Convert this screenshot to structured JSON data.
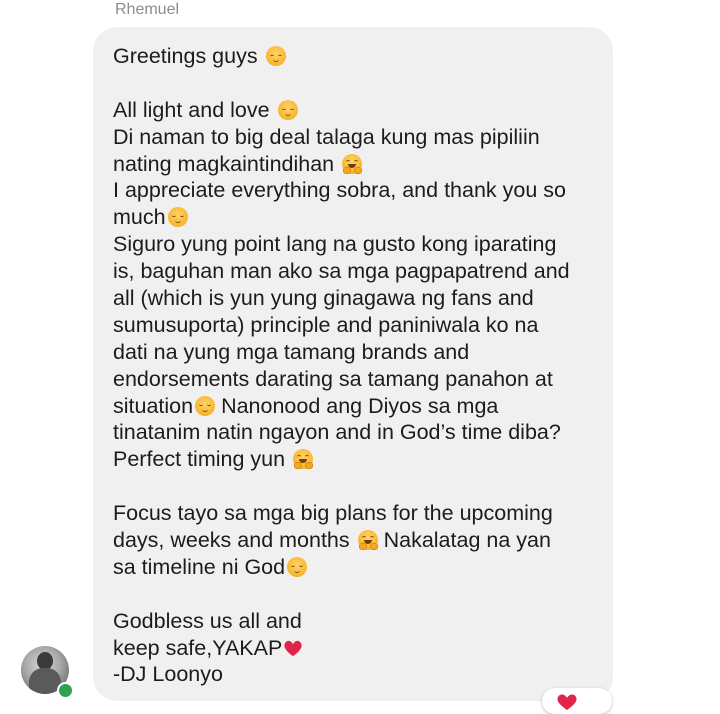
{
  "sender": {
    "name": "Rhemuel"
  },
  "message": {
    "lines": [
      {
        "text": "Greetings guys ",
        "emoji": "relieved-face-icon"
      },
      {
        "text": "",
        "emoji": ""
      },
      {
        "text": "All light and love ",
        "emoji": "relieved-face-icon"
      },
      {
        "text": "Di naman to big deal talaga kung mas pipiliin",
        "emoji": ""
      },
      {
        "text": "nating magkaintindihan ",
        "emoji": "hugging-face-icon"
      },
      {
        "text": "I appreciate everything sobra, and thank you so",
        "emoji": ""
      },
      {
        "text": "much",
        "emoji": "relieved-face-icon"
      },
      {
        "text": "Siguro yung point lang na gusto kong iparating",
        "emoji": ""
      },
      {
        "text": "is, baguhan man ako sa mga pagpapatrend and",
        "emoji": ""
      },
      {
        "text": "all (which is yun yung ginagawa ng fans and",
        "emoji": ""
      },
      {
        "text": "sumusuporta) principle and paniniwala ko na",
        "emoji": ""
      },
      {
        "text": "dati na yung mga tamang brands and",
        "emoji": ""
      },
      {
        "text": "endorsements darating sa tamang panahon at",
        "emoji": ""
      },
      {
        "text": "situation",
        "emoji": "relieved-face-icon",
        "after": " Nanonood ang Diyos sa mga"
      },
      {
        "text": "tinatanim natin ngayon and in God’s time diba?",
        "emoji": ""
      },
      {
        "text": "Perfect timing yun ",
        "emoji": "hugging-face-icon"
      },
      {
        "text": "",
        "emoji": ""
      },
      {
        "text": "Focus tayo sa mga big plans for the upcoming",
        "emoji": ""
      },
      {
        "text": "days, weeks and months ",
        "emoji": "hugging-face-icon",
        "after": " Nakalatag na yan"
      },
      {
        "text": "sa timeline ni God",
        "emoji": "relieved-face-icon"
      },
      {
        "text": "",
        "emoji": ""
      },
      {
        "text": "Godbless us all and",
        "emoji": ""
      },
      {
        "text": "keep safe,YAKAP",
        "emoji": "red-heart-icon"
      },
      {
        "text": "-DJ Loonyo",
        "emoji": ""
      }
    ]
  },
  "colors": {
    "bubble": "#f0f0f0",
    "text": "#1c1c1c",
    "sender_name": "#8a8d91",
    "online": "#31a24c",
    "heart": "#e0244a"
  },
  "avatar": {
    "icon": "profile-photo",
    "online": true
  },
  "reaction": {
    "icon": "red-heart-icon"
  }
}
